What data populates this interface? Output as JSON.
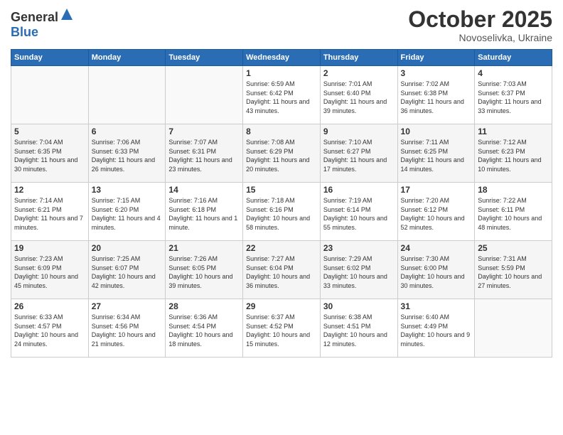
{
  "header": {
    "logo_general": "General",
    "logo_blue": "Blue",
    "month_title": "October 2025",
    "location": "Novoselivka, Ukraine"
  },
  "days_of_week": [
    "Sunday",
    "Monday",
    "Tuesday",
    "Wednesday",
    "Thursday",
    "Friday",
    "Saturday"
  ],
  "weeks": [
    [
      {
        "day": "",
        "sunrise": "",
        "sunset": "",
        "daylight": ""
      },
      {
        "day": "",
        "sunrise": "",
        "sunset": "",
        "daylight": ""
      },
      {
        "day": "",
        "sunrise": "",
        "sunset": "",
        "daylight": ""
      },
      {
        "day": "1",
        "sunrise": "Sunrise: 6:59 AM",
        "sunset": "Sunset: 6:42 PM",
        "daylight": "Daylight: 11 hours and 43 minutes."
      },
      {
        "day": "2",
        "sunrise": "Sunrise: 7:01 AM",
        "sunset": "Sunset: 6:40 PM",
        "daylight": "Daylight: 11 hours and 39 minutes."
      },
      {
        "day": "3",
        "sunrise": "Sunrise: 7:02 AM",
        "sunset": "Sunset: 6:38 PM",
        "daylight": "Daylight: 11 hours and 36 minutes."
      },
      {
        "day": "4",
        "sunrise": "Sunrise: 7:03 AM",
        "sunset": "Sunset: 6:37 PM",
        "daylight": "Daylight: 11 hours and 33 minutes."
      }
    ],
    [
      {
        "day": "5",
        "sunrise": "Sunrise: 7:04 AM",
        "sunset": "Sunset: 6:35 PM",
        "daylight": "Daylight: 11 hours and 30 minutes."
      },
      {
        "day": "6",
        "sunrise": "Sunrise: 7:06 AM",
        "sunset": "Sunset: 6:33 PM",
        "daylight": "Daylight: 11 hours and 26 minutes."
      },
      {
        "day": "7",
        "sunrise": "Sunrise: 7:07 AM",
        "sunset": "Sunset: 6:31 PM",
        "daylight": "Daylight: 11 hours and 23 minutes."
      },
      {
        "day": "8",
        "sunrise": "Sunrise: 7:08 AM",
        "sunset": "Sunset: 6:29 PM",
        "daylight": "Daylight: 11 hours and 20 minutes."
      },
      {
        "day": "9",
        "sunrise": "Sunrise: 7:10 AM",
        "sunset": "Sunset: 6:27 PM",
        "daylight": "Daylight: 11 hours and 17 minutes."
      },
      {
        "day": "10",
        "sunrise": "Sunrise: 7:11 AM",
        "sunset": "Sunset: 6:25 PM",
        "daylight": "Daylight: 11 hours and 14 minutes."
      },
      {
        "day": "11",
        "sunrise": "Sunrise: 7:12 AM",
        "sunset": "Sunset: 6:23 PM",
        "daylight": "Daylight: 11 hours and 10 minutes."
      }
    ],
    [
      {
        "day": "12",
        "sunrise": "Sunrise: 7:14 AM",
        "sunset": "Sunset: 6:21 PM",
        "daylight": "Daylight: 11 hours and 7 minutes."
      },
      {
        "day": "13",
        "sunrise": "Sunrise: 7:15 AM",
        "sunset": "Sunset: 6:20 PM",
        "daylight": "Daylight: 11 hours and 4 minutes."
      },
      {
        "day": "14",
        "sunrise": "Sunrise: 7:16 AM",
        "sunset": "Sunset: 6:18 PM",
        "daylight": "Daylight: 11 hours and 1 minute."
      },
      {
        "day": "15",
        "sunrise": "Sunrise: 7:18 AM",
        "sunset": "Sunset: 6:16 PM",
        "daylight": "Daylight: 10 hours and 58 minutes."
      },
      {
        "day": "16",
        "sunrise": "Sunrise: 7:19 AM",
        "sunset": "Sunset: 6:14 PM",
        "daylight": "Daylight: 10 hours and 55 minutes."
      },
      {
        "day": "17",
        "sunrise": "Sunrise: 7:20 AM",
        "sunset": "Sunset: 6:12 PM",
        "daylight": "Daylight: 10 hours and 52 minutes."
      },
      {
        "day": "18",
        "sunrise": "Sunrise: 7:22 AM",
        "sunset": "Sunset: 6:11 PM",
        "daylight": "Daylight: 10 hours and 48 minutes."
      }
    ],
    [
      {
        "day": "19",
        "sunrise": "Sunrise: 7:23 AM",
        "sunset": "Sunset: 6:09 PM",
        "daylight": "Daylight: 10 hours and 45 minutes."
      },
      {
        "day": "20",
        "sunrise": "Sunrise: 7:25 AM",
        "sunset": "Sunset: 6:07 PM",
        "daylight": "Daylight: 10 hours and 42 minutes."
      },
      {
        "day": "21",
        "sunrise": "Sunrise: 7:26 AM",
        "sunset": "Sunset: 6:05 PM",
        "daylight": "Daylight: 10 hours and 39 minutes."
      },
      {
        "day": "22",
        "sunrise": "Sunrise: 7:27 AM",
        "sunset": "Sunset: 6:04 PM",
        "daylight": "Daylight: 10 hours and 36 minutes."
      },
      {
        "day": "23",
        "sunrise": "Sunrise: 7:29 AM",
        "sunset": "Sunset: 6:02 PM",
        "daylight": "Daylight: 10 hours and 33 minutes."
      },
      {
        "day": "24",
        "sunrise": "Sunrise: 7:30 AM",
        "sunset": "Sunset: 6:00 PM",
        "daylight": "Daylight: 10 hours and 30 minutes."
      },
      {
        "day": "25",
        "sunrise": "Sunrise: 7:31 AM",
        "sunset": "Sunset: 5:59 PM",
        "daylight": "Daylight: 10 hours and 27 minutes."
      }
    ],
    [
      {
        "day": "26",
        "sunrise": "Sunrise: 6:33 AM",
        "sunset": "Sunset: 4:57 PM",
        "daylight": "Daylight: 10 hours and 24 minutes."
      },
      {
        "day": "27",
        "sunrise": "Sunrise: 6:34 AM",
        "sunset": "Sunset: 4:56 PM",
        "daylight": "Daylight: 10 hours and 21 minutes."
      },
      {
        "day": "28",
        "sunrise": "Sunrise: 6:36 AM",
        "sunset": "Sunset: 4:54 PM",
        "daylight": "Daylight: 10 hours and 18 minutes."
      },
      {
        "day": "29",
        "sunrise": "Sunrise: 6:37 AM",
        "sunset": "Sunset: 4:52 PM",
        "daylight": "Daylight: 10 hours and 15 minutes."
      },
      {
        "day": "30",
        "sunrise": "Sunrise: 6:38 AM",
        "sunset": "Sunset: 4:51 PM",
        "daylight": "Daylight: 10 hours and 12 minutes."
      },
      {
        "day": "31",
        "sunrise": "Sunrise: 6:40 AM",
        "sunset": "Sunset: 4:49 PM",
        "daylight": "Daylight: 10 hours and 9 minutes."
      },
      {
        "day": "",
        "sunrise": "",
        "sunset": "",
        "daylight": ""
      }
    ]
  ]
}
